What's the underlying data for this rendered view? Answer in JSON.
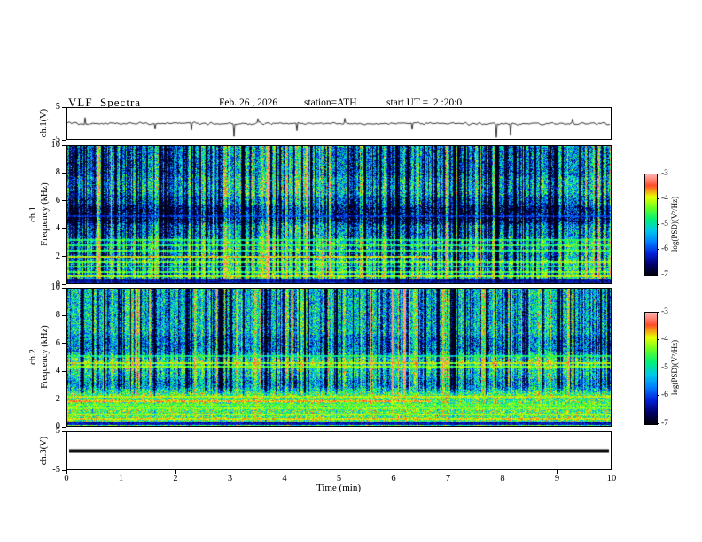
{
  "title": "VLF  Spectra",
  "header": {
    "date": "Feb. 26 , 2026",
    "station": "station=ATH",
    "start_ut": "start UT =  2 :20:0"
  },
  "axes": {
    "x": {
      "label": "Time (min)",
      "min": 0,
      "max": 10,
      "ticks": [
        0,
        1,
        2,
        3,
        4,
        5,
        6,
        7,
        8,
        9,
        10
      ]
    },
    "panels": [
      {
        "key": "wave1",
        "ylabel": "ch.1(V)",
        "ymin": -5,
        "ymax": 5,
        "yticks": [
          5,
          -5
        ]
      },
      {
        "key": "spec1",
        "ylabel_ch": "ch.1",
        "ylabel_freq": "Frequency (kHz)",
        "ymin": 0,
        "ymax": 10,
        "yticks": [
          10,
          8,
          6,
          4,
          2,
          0
        ]
      },
      {
        "key": "spec2",
        "ylabel_ch": "ch.2",
        "ylabel_freq": "Frequency (kHz)",
        "ymin": 0,
        "ymax": 10,
        "yticks": [
          10,
          8,
          6,
          4,
          2,
          0
        ]
      },
      {
        "key": "wave3",
        "ylabel": "ch.3(V)",
        "ymin": -5,
        "ymax": 5,
        "yticks": [
          5,
          -5
        ]
      }
    ]
  },
  "colorbar": {
    "label": "log(PSD)(V²/Hz)",
    "min": -7,
    "max": -3,
    "ticks": [
      -3,
      -4,
      -5,
      -6,
      -7
    ],
    "colormap_stops": [
      "#000006",
      "#00006e",
      "#0022dd",
      "#0080ff",
      "#00c8e8",
      "#00f078",
      "#66ff22",
      "#e6ff00",
      "#ff4c28",
      "#ffb4b4"
    ]
  },
  "chart_data": [
    {
      "type": "line",
      "name": "ch.1 voltage waveform",
      "x_unit": "min",
      "y_unit": "V",
      "x_range": [
        0,
        10
      ],
      "y_range": [
        -5,
        5
      ],
      "baseline_V": 0,
      "noise_amp_V": 0.4,
      "seed": 20260226,
      "spikes": [
        {
          "t": 0.32,
          "v": 1.9
        },
        {
          "t": 1.62,
          "v": -1.8
        },
        {
          "t": 2.28,
          "v": -2.1
        },
        {
          "t": 3.06,
          "v": -4.2
        },
        {
          "t": 3.5,
          "v": 1.6
        },
        {
          "t": 4.22,
          "v": -2.3
        },
        {
          "t": 5.1,
          "v": 1.7
        },
        {
          "t": 6.35,
          "v": -1.9
        },
        {
          "t": 7.9,
          "v": -4.5
        },
        {
          "t": 8.16,
          "v": -3.6
        },
        {
          "t": 9.3,
          "v": 1.5
        }
      ]
    },
    {
      "type": "heatmap",
      "name": "ch.1 spectrogram",
      "x_range": [
        0,
        10
      ],
      "y_range_kHz": [
        0,
        10
      ],
      "z_range_logPSD": [
        -7,
        -3
      ],
      "seed": 101,
      "base": 0.47,
      "noise": 0.26,
      "streaks": {
        "count": 330,
        "bright_frac": 0.32,
        "fade_below_kHz": 0.8
      },
      "bands": [
        [
          4.4,
          5.7,
          -0.3
        ],
        [
          5.7,
          6.4,
          -0.14
        ],
        [
          7.8,
          10.0,
          -0.1
        ],
        [
          3.4,
          4.4,
          -0.08
        ],
        [
          0.0,
          1.8,
          0.1
        ],
        [
          2.3,
          3.3,
          0.06
        ]
      ],
      "lines": [
        [
          1.95,
          1,
          0.88,
          0,
          6.7
        ],
        [
          2.45,
          1,
          0.68,
          0,
          10
        ],
        [
          2.8,
          1,
          0.66,
          0,
          10
        ],
        [
          3.2,
          1,
          0.64,
          0,
          10
        ],
        [
          0.25,
          2,
          0.06,
          0,
          10
        ],
        [
          0.55,
          1,
          0.8,
          0,
          10
        ],
        [
          0.9,
          1,
          0.72,
          0,
          10
        ],
        [
          1.25,
          1,
          0.62,
          0,
          10
        ],
        [
          1.55,
          1,
          0.74,
          0,
          10
        ],
        [
          4.95,
          1,
          0.3,
          0,
          10
        ]
      ],
      "patches": [
        [
          3.15,
          3.5,
          4.5,
          10,
          0.12
        ],
        [
          4.0,
          4.55,
          3.5,
          10,
          0.16
        ],
        [
          6.15,
          6.5,
          5,
          10,
          0.1
        ]
      ]
    },
    {
      "type": "heatmap",
      "name": "ch.2 spectrogram",
      "x_range": [
        0,
        10
      ],
      "y_range_kHz": [
        0,
        10
      ],
      "z_range_logPSD": [
        -7,
        -3
      ],
      "seed": 202,
      "base": 0.52,
      "noise": 0.24,
      "streaks": {
        "count": 300,
        "bright_frac": 0.3,
        "fade_below_kHz": 3.2
      },
      "bands": [
        [
          5.3,
          6.6,
          -0.16
        ],
        [
          2.8,
          3.5,
          -0.1
        ],
        [
          4.2,
          5.0,
          0.1
        ],
        [
          0.0,
          2.5,
          0.12
        ],
        [
          6.6,
          10.0,
          -0.06
        ]
      ],
      "lines": [
        [
          4.6,
          1,
          0.8,
          0,
          10
        ],
        [
          4.35,
          1,
          0.74,
          0,
          10
        ],
        [
          1.85,
          1,
          0.88,
          0,
          6.7
        ],
        [
          2.15,
          1,
          0.78,
          0,
          10
        ],
        [
          0.25,
          2,
          0.08,
          0,
          10
        ],
        [
          0.55,
          1,
          0.82,
          0,
          10
        ],
        [
          0.9,
          1,
          0.74,
          0,
          10
        ],
        [
          1.3,
          1,
          0.7,
          0,
          10
        ],
        [
          1.6,
          1,
          0.66,
          0,
          10
        ],
        [
          5.15,
          1,
          0.6,
          0,
          10
        ]
      ],
      "patches": [
        [
          1.0,
          1.3,
          4,
          10,
          0.1
        ],
        [
          4.0,
          4.4,
          4,
          10,
          0.12
        ]
      ]
    },
    {
      "type": "line",
      "name": "ch.3 voltage waveform (flat)",
      "x_range": [
        0,
        10
      ],
      "y_range": [
        -5,
        5
      ],
      "value_V": 0,
      "thickness_px": 3
    }
  ]
}
